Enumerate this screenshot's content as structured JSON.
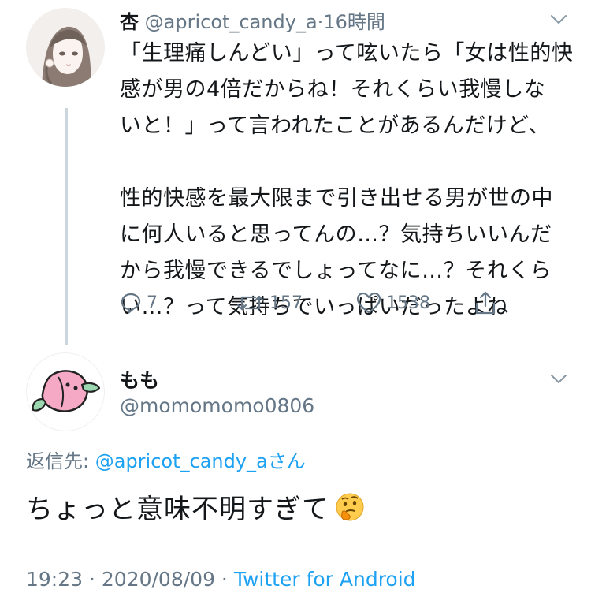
{
  "parent_tweet": {
    "display_name": "杏",
    "handle": "@apricot_candy_a",
    "separator": "·",
    "time_ago": "16時間",
    "text_lines": [
      "「生理痛しんどい」って呟いたら「女は性的快",
      "感が男の4倍だからね！それくらい我慢しな",
      "いと！」って言われたことがあるんだけど、",
      "",
      "性的快感を最大限まで引き出せる男が世の中",
      "に何人いると思ってんの…？気持ちいいんだ",
      "から我慢できるでしょってなに…？それくら",
      "い…？って気持ちでいっぱいだったよね"
    ],
    "replies": "7",
    "retweets": "157",
    "likes": "1538"
  },
  "reply_tweet": {
    "display_name": "もも",
    "handle": "@momomomo0806",
    "reply_to_label": "返信先:",
    "reply_to_handle": "@apricot_candy_aさん",
    "text": "ちょっと意味不明すぎて",
    "emoji_icon": "thinking-face-icon",
    "timestamp": "19:23 · 2020/08/09 · ",
    "source": "Twitter for Android"
  },
  "colors": {
    "text": "#14171a",
    "meta": "#657786",
    "link": "#1da1f2",
    "thread_line": "#ccd6dd"
  }
}
